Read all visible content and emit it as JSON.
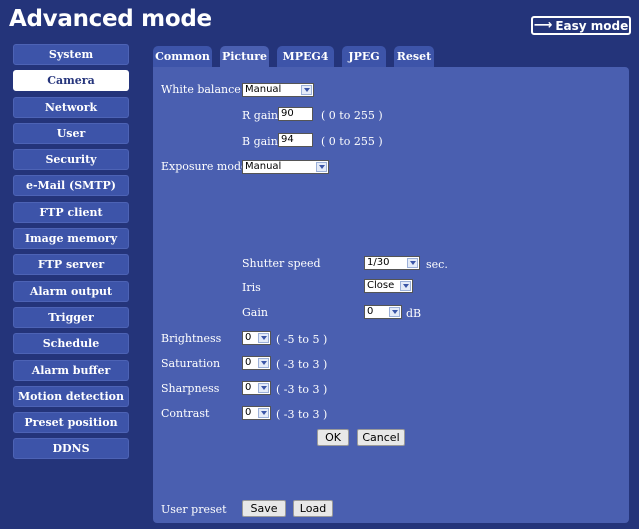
{
  "header": {
    "title": "Advanced mode",
    "easy_mode_label": "Easy mode"
  },
  "sidebar": {
    "items": [
      {
        "label": "System",
        "active": false
      },
      {
        "label": "Camera",
        "active": true
      },
      {
        "label": "Network",
        "active": false
      },
      {
        "label": "User",
        "active": false
      },
      {
        "label": "Security",
        "active": false
      },
      {
        "label": "e-Mail (SMTP)",
        "active": false
      },
      {
        "label": "FTP client",
        "active": false
      },
      {
        "label": "Image memory",
        "active": false
      },
      {
        "label": "FTP server",
        "active": false
      },
      {
        "label": "Alarm output",
        "active": false
      },
      {
        "label": "Trigger",
        "active": false
      },
      {
        "label": "Schedule",
        "active": false
      },
      {
        "label": "Alarm buffer",
        "active": false
      },
      {
        "label": "Motion detection",
        "active": false
      },
      {
        "label": "Preset position",
        "active": false
      },
      {
        "label": "DDNS",
        "active": false
      }
    ]
  },
  "tabs": [
    {
      "label": "Common",
      "active": false
    },
    {
      "label": "Picture",
      "active": true
    },
    {
      "label": "MPEG4",
      "active": false
    },
    {
      "label": "JPEG",
      "active": false
    },
    {
      "label": "Reset",
      "active": false
    }
  ],
  "picture": {
    "white_balance": {
      "label": "White balance",
      "value": "Manual"
    },
    "r_gain": {
      "label": "R gain",
      "value": "90",
      "range": "( 0 to 255 )"
    },
    "b_gain": {
      "label": "B gain",
      "value": "94",
      "range": "( 0 to 255 )"
    },
    "exposure_mode": {
      "label": "Exposure mode",
      "value": "Manual"
    },
    "shutter_speed": {
      "label": "Shutter speed",
      "value": "1/30",
      "unit": "sec."
    },
    "iris": {
      "label": "Iris",
      "value": "Close"
    },
    "gain": {
      "label": "Gain",
      "value": "0",
      "unit": "dB"
    },
    "brightness": {
      "label": "Brightness",
      "value": "0",
      "range": "( -5 to 5 )"
    },
    "saturation": {
      "label": "Saturation",
      "value": "0",
      "range": "( -3 to 3 )"
    },
    "sharpness": {
      "label": "Sharpness",
      "value": "0",
      "range": "( -3 to 3 )"
    },
    "contrast": {
      "label": "Contrast",
      "value": "0",
      "range": "( -3 to 3 )"
    },
    "ok_label": "OK",
    "cancel_label": "Cancel",
    "user_preset": {
      "label": "User preset",
      "save_label": "Save",
      "load_label": "Load"
    }
  },
  "colors": {
    "background": "#24347a",
    "panel": "#4a5fb0",
    "sidebar_item": "#3d54a9",
    "sidebar_active": "#ffffff"
  }
}
